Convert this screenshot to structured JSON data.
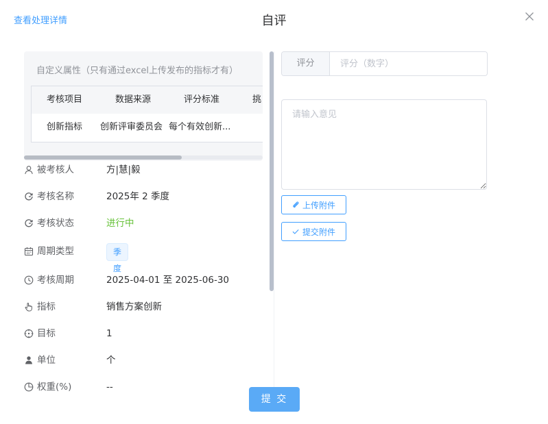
{
  "header": {
    "link_label": "查看处理详情",
    "title": "自评"
  },
  "custom_attrs": {
    "title": "自定义属性（只有通过excel上传发布的指标才有）",
    "columns": [
      "考核项目",
      "数据来源",
      "评分标准",
      "挑"
    ],
    "rows": [
      [
        "创新指标",
        "创新评审委员会",
        "每个有效创新...",
        ""
      ]
    ],
    "scroll_fraction": 0.66
  },
  "info": {
    "assessee": {
      "label": "被考核人",
      "value": "方|慧|毅",
      "icon": "user-icon"
    },
    "name": {
      "label": "考核名称",
      "value": "2025年 2 季度",
      "icon": "refresh-icon"
    },
    "status": {
      "label": "考核状态",
      "value": "进行中",
      "icon": "refresh-icon"
    },
    "cycle_type": {
      "label": "周期类型",
      "value": "季度",
      "icon": "calendar-icon"
    },
    "period": {
      "label": "考核周期",
      "value": "2025-04-01 至 2025-06-30",
      "icon": "clock-icon"
    },
    "indicator": {
      "label": "指标",
      "value": "销售方案创新",
      "icon": "pointer-icon"
    },
    "target": {
      "label": "目标",
      "value": "1",
      "icon": "target-icon"
    },
    "unit": {
      "label": "单位",
      "value": "个",
      "icon": "person-icon"
    },
    "weight": {
      "label": "权重(%)",
      "value": "--",
      "icon": "pie-icon"
    }
  },
  "form": {
    "score_label": "评分",
    "score_placeholder": "评分（数字）",
    "opinion_placeholder": "请输入意见",
    "upload_label": "上传附件",
    "submit_attach_label": "提交附件"
  },
  "footer": {
    "submit_label": "提 交"
  },
  "colors": {
    "primary": "#409eff",
    "submit_bg": "#5aaaf6",
    "status_green": "#67c23a"
  }
}
